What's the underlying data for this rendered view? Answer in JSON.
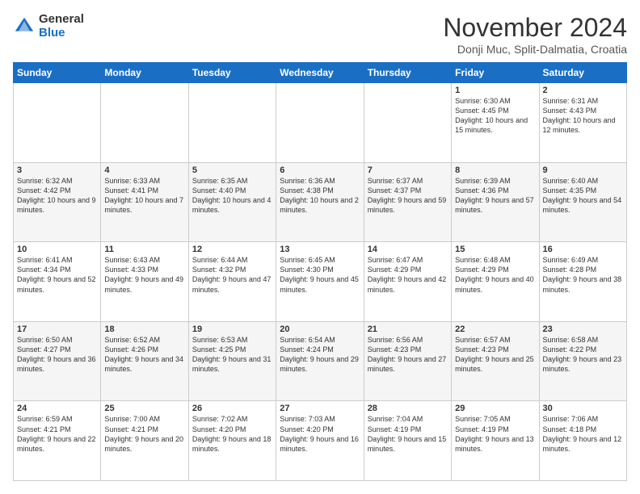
{
  "logo": {
    "general": "General",
    "blue": "Blue"
  },
  "title": "November 2024",
  "location": "Donji Muc, Split-Dalmatia, Croatia",
  "days_header": [
    "Sunday",
    "Monday",
    "Tuesday",
    "Wednesday",
    "Thursday",
    "Friday",
    "Saturday"
  ],
  "weeks": [
    [
      {
        "day": "",
        "info": ""
      },
      {
        "day": "",
        "info": ""
      },
      {
        "day": "",
        "info": ""
      },
      {
        "day": "",
        "info": ""
      },
      {
        "day": "",
        "info": ""
      },
      {
        "day": "1",
        "info": "Sunrise: 6:30 AM\nSunset: 4:45 PM\nDaylight: 10 hours and 15 minutes."
      },
      {
        "day": "2",
        "info": "Sunrise: 6:31 AM\nSunset: 4:43 PM\nDaylight: 10 hours and 12 minutes."
      }
    ],
    [
      {
        "day": "3",
        "info": "Sunrise: 6:32 AM\nSunset: 4:42 PM\nDaylight: 10 hours and 9 minutes."
      },
      {
        "day": "4",
        "info": "Sunrise: 6:33 AM\nSunset: 4:41 PM\nDaylight: 10 hours and 7 minutes."
      },
      {
        "day": "5",
        "info": "Sunrise: 6:35 AM\nSunset: 4:40 PM\nDaylight: 10 hours and 4 minutes."
      },
      {
        "day": "6",
        "info": "Sunrise: 6:36 AM\nSunset: 4:38 PM\nDaylight: 10 hours and 2 minutes."
      },
      {
        "day": "7",
        "info": "Sunrise: 6:37 AM\nSunset: 4:37 PM\nDaylight: 9 hours and 59 minutes."
      },
      {
        "day": "8",
        "info": "Sunrise: 6:39 AM\nSunset: 4:36 PM\nDaylight: 9 hours and 57 minutes."
      },
      {
        "day": "9",
        "info": "Sunrise: 6:40 AM\nSunset: 4:35 PM\nDaylight: 9 hours and 54 minutes."
      }
    ],
    [
      {
        "day": "10",
        "info": "Sunrise: 6:41 AM\nSunset: 4:34 PM\nDaylight: 9 hours and 52 minutes."
      },
      {
        "day": "11",
        "info": "Sunrise: 6:43 AM\nSunset: 4:33 PM\nDaylight: 9 hours and 49 minutes."
      },
      {
        "day": "12",
        "info": "Sunrise: 6:44 AM\nSunset: 4:32 PM\nDaylight: 9 hours and 47 minutes."
      },
      {
        "day": "13",
        "info": "Sunrise: 6:45 AM\nSunset: 4:30 PM\nDaylight: 9 hours and 45 minutes."
      },
      {
        "day": "14",
        "info": "Sunrise: 6:47 AM\nSunset: 4:29 PM\nDaylight: 9 hours and 42 minutes."
      },
      {
        "day": "15",
        "info": "Sunrise: 6:48 AM\nSunset: 4:29 PM\nDaylight: 9 hours and 40 minutes."
      },
      {
        "day": "16",
        "info": "Sunrise: 6:49 AM\nSunset: 4:28 PM\nDaylight: 9 hours and 38 minutes."
      }
    ],
    [
      {
        "day": "17",
        "info": "Sunrise: 6:50 AM\nSunset: 4:27 PM\nDaylight: 9 hours and 36 minutes."
      },
      {
        "day": "18",
        "info": "Sunrise: 6:52 AM\nSunset: 4:26 PM\nDaylight: 9 hours and 34 minutes."
      },
      {
        "day": "19",
        "info": "Sunrise: 6:53 AM\nSunset: 4:25 PM\nDaylight: 9 hours and 31 minutes."
      },
      {
        "day": "20",
        "info": "Sunrise: 6:54 AM\nSunset: 4:24 PM\nDaylight: 9 hours and 29 minutes."
      },
      {
        "day": "21",
        "info": "Sunrise: 6:56 AM\nSunset: 4:23 PM\nDaylight: 9 hours and 27 minutes."
      },
      {
        "day": "22",
        "info": "Sunrise: 6:57 AM\nSunset: 4:23 PM\nDaylight: 9 hours and 25 minutes."
      },
      {
        "day": "23",
        "info": "Sunrise: 6:58 AM\nSunset: 4:22 PM\nDaylight: 9 hours and 23 minutes."
      }
    ],
    [
      {
        "day": "24",
        "info": "Sunrise: 6:59 AM\nSunset: 4:21 PM\nDaylight: 9 hours and 22 minutes."
      },
      {
        "day": "25",
        "info": "Sunrise: 7:00 AM\nSunset: 4:21 PM\nDaylight: 9 hours and 20 minutes."
      },
      {
        "day": "26",
        "info": "Sunrise: 7:02 AM\nSunset: 4:20 PM\nDaylight: 9 hours and 18 minutes."
      },
      {
        "day": "27",
        "info": "Sunrise: 7:03 AM\nSunset: 4:20 PM\nDaylight: 9 hours and 16 minutes."
      },
      {
        "day": "28",
        "info": "Sunrise: 7:04 AM\nSunset: 4:19 PM\nDaylight: 9 hours and 15 minutes."
      },
      {
        "day": "29",
        "info": "Sunrise: 7:05 AM\nSunset: 4:19 PM\nDaylight: 9 hours and 13 minutes."
      },
      {
        "day": "30",
        "info": "Sunrise: 7:06 AM\nSunset: 4:18 PM\nDaylight: 9 hours and 12 minutes."
      }
    ]
  ]
}
